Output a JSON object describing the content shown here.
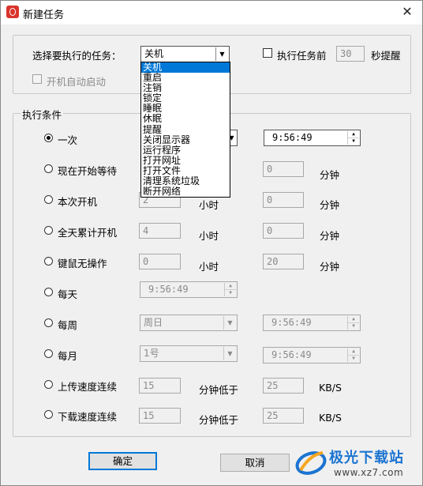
{
  "window": {
    "title": "新建任务",
    "close_symbol": "✕"
  },
  "task_select": {
    "label": "选择要执行的任务：",
    "value": "关机",
    "options": [
      "关机",
      "重启",
      "注销",
      "锁定",
      "睡眠",
      "休眠",
      "提醒",
      "关闭显示器",
      "运行程序",
      "打开网址",
      "打开文件",
      "清理系统垃圾",
      "断开网络"
    ],
    "selected_index": 0
  },
  "pre_reminder": {
    "label": "执行任务前",
    "value": "30",
    "suffix": "秒提醒"
  },
  "autostart": {
    "label": "开机自动启动"
  },
  "conditions": {
    "title": "执行条件",
    "rows": [
      {
        "label": "一次",
        "checked": true,
        "time": "9:56:49"
      },
      {
        "label": "现在开始等待",
        "checked": false,
        "field2": "0",
        "unit2": "分钟"
      },
      {
        "label": "本次开机",
        "checked": false,
        "field1": "2",
        "unit1": "小时",
        "field2": "0",
        "unit2": "分钟"
      },
      {
        "label": "全天累计开机",
        "checked": false,
        "field1": "4",
        "unit1": "小时",
        "field2": "0",
        "unit2": "分钟"
      },
      {
        "label": "键鼠无操作",
        "checked": false,
        "field1": "0",
        "unit1": "小时",
        "field2": "20",
        "unit2": "分钟"
      },
      {
        "label": "每天",
        "checked": false,
        "time": "9:56:49"
      },
      {
        "label": "每周",
        "checked": false,
        "combo": "周日",
        "time": "9:56:49"
      },
      {
        "label": "每月",
        "checked": false,
        "combo": "1号",
        "time": "9:56:49"
      },
      {
        "label": "上传速度连续",
        "checked": false,
        "field1": "15",
        "unit1": "分钟低于",
        "field2": "25",
        "unit2": "KB/S"
      },
      {
        "label": "下载速度连续",
        "checked": false,
        "field1": "15",
        "unit1": "分钟低于",
        "field2": "25",
        "unit2": "KB/S"
      }
    ]
  },
  "buttons": {
    "ok": "确定",
    "cancel": "取消"
  },
  "watermark": {
    "brand": "极光下载站",
    "url": "www.xz7.com"
  },
  "colors": {
    "accent": "#0078d7",
    "watermark_blue": "#1b74d1",
    "app_icon": "#d9342b"
  }
}
